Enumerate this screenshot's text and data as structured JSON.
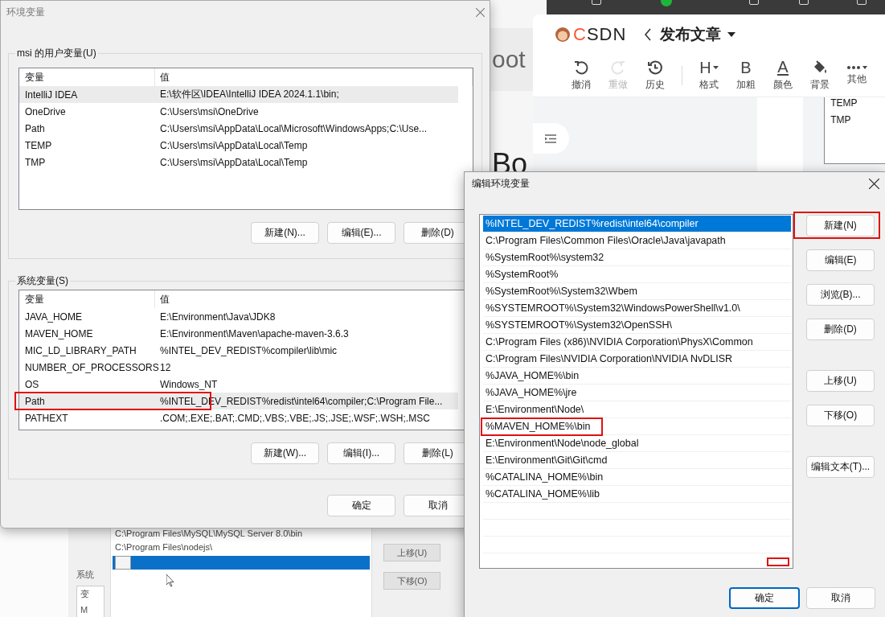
{
  "background_page": {
    "fragments": [
      "oot",
      "Bo"
    ]
  },
  "csdn_editor": {
    "logo": "CSDN",
    "title": "发布文章",
    "toolbar": [
      {
        "kind": "undo",
        "label": "撤消",
        "disabled": false
      },
      {
        "kind": "redo",
        "label": "重做",
        "disabled": true
      },
      {
        "kind": "history",
        "label": "历史",
        "disabled": false
      },
      {
        "kind": "heading",
        "label": "格式",
        "glyph": "H",
        "disabled": false
      },
      {
        "kind": "bold",
        "label": "加粗",
        "glyph": "B",
        "disabled": false
      },
      {
        "kind": "color",
        "label": "颜色",
        "glyph": "A",
        "disabled": false
      },
      {
        "kind": "background",
        "label": "背景",
        "disabled": false
      },
      {
        "kind": "more",
        "label": "其他",
        "disabled": false
      }
    ],
    "side_list": [
      "TEMP",
      "TMP"
    ]
  },
  "back_dialog": {
    "group_label": "系统",
    "column_fragments": [
      "变",
      "M"
    ],
    "entries": [
      "C:\\Program Files\\MySQL\\MySQL Server 8.0\\bin",
      "C:\\Program Files\\nodejs\\"
    ],
    "editing_row": {
      "selected": true
    },
    "buttons": [
      "上移(U)",
      "下移(O)"
    ]
  },
  "env_dialog": {
    "title": "环境变量",
    "groups": [
      {
        "label": "msi 的用户变量(U)",
        "columns": [
          "变量",
          "值"
        ],
        "rows": [
          {
            "name": "IntelliJ IDEA",
            "value": "E:\\软件区\\IDEA\\IntelliJ IDEA 2024.1.1\\bin;",
            "selected": true,
            "highlighted": false
          },
          {
            "name": "OneDrive",
            "value": "C:\\Users\\msi\\OneDrive",
            "selected": false,
            "highlighted": false
          },
          {
            "name": "Path",
            "value": "C:\\Users\\msi\\AppData\\Local\\Microsoft\\WindowsApps;C:\\Use...",
            "selected": false,
            "highlighted": false
          },
          {
            "name": "TEMP",
            "value": "C:\\Users\\msi\\AppData\\Local\\Temp",
            "selected": false,
            "highlighted": false
          },
          {
            "name": "TMP",
            "value": "C:\\Users\\msi\\AppData\\Local\\Temp",
            "selected": false,
            "highlighted": false
          }
        ],
        "buttons": [
          "新建(N)...",
          "编辑(E)...",
          "删除(D)"
        ]
      },
      {
        "label": "系统变量(S)",
        "columns": [
          "变量",
          "值"
        ],
        "rows": [
          {
            "name": "JAVA_HOME",
            "value": "E:\\Environment\\Java\\JDK8",
            "selected": false,
            "highlighted": false
          },
          {
            "name": "MAVEN_HOME",
            "value": "E:\\Environment\\Maven\\apache-maven-3.6.3",
            "selected": false,
            "highlighted": false
          },
          {
            "name": "MIC_LD_LIBRARY_PATH",
            "value": "%INTEL_DEV_REDIST%compiler\\lib\\mic",
            "selected": false,
            "highlighted": false
          },
          {
            "name": "NUMBER_OF_PROCESSORS",
            "value": "12",
            "selected": false,
            "highlighted": false
          },
          {
            "name": "OS",
            "value": "Windows_NT",
            "selected": false,
            "highlighted": false
          },
          {
            "name": "Path",
            "value": "%INTEL_DEV_REDIST%redist\\intel64\\compiler;C:\\Program File...",
            "selected": true,
            "highlighted": true
          },
          {
            "name": "PATHEXT",
            "value": ".COM;.EXE;.BAT;.CMD;.VBS;.VBE;.JS;.JSE;.WSF;.WSH;.MSC",
            "selected": false,
            "highlighted": false
          }
        ],
        "buttons": [
          "新建(W)...",
          "编辑(I)...",
          "删除(L)"
        ]
      }
    ],
    "footer_buttons": [
      "确定",
      "取消"
    ]
  },
  "edit_dialog": {
    "title": "编辑环境变量",
    "entries": [
      {
        "text": "%INTEL_DEV_REDIST%redist\\intel64\\compiler",
        "selected": true,
        "highlighted": false
      },
      {
        "text": "C:\\Program Files\\Common Files\\Oracle\\Java\\javapath",
        "selected": false,
        "highlighted": false
      },
      {
        "text": "%SystemRoot%\\system32",
        "selected": false,
        "highlighted": false
      },
      {
        "text": "%SystemRoot%",
        "selected": false,
        "highlighted": false
      },
      {
        "text": "%SystemRoot%\\System32\\Wbem",
        "selected": false,
        "highlighted": false
      },
      {
        "text": "%SYSTEMROOT%\\System32\\WindowsPowerShell\\v1.0\\",
        "selected": false,
        "highlighted": false
      },
      {
        "text": "%SYSTEMROOT%\\System32\\OpenSSH\\",
        "selected": false,
        "highlighted": false
      },
      {
        "text": "C:\\Program Files (x86)\\NVIDIA Corporation\\PhysX\\Common",
        "selected": false,
        "highlighted": false
      },
      {
        "text": "C:\\Program Files\\NVIDIA Corporation\\NVIDIA NvDLISR",
        "selected": false,
        "highlighted": false
      },
      {
        "text": "%JAVA_HOME%\\bin",
        "selected": false,
        "highlighted": false
      },
      {
        "text": "%JAVA_HOME%\\jre",
        "selected": false,
        "highlighted": false
      },
      {
        "text": "E:\\Environment\\Node\\",
        "selected": false,
        "highlighted": false
      },
      {
        "text": "%MAVEN_HOME%\\bin",
        "selected": false,
        "highlighted": true
      },
      {
        "text": "E:\\Environment\\Node\\node_global",
        "selected": false,
        "highlighted": false
      },
      {
        "text": "E:\\Environment\\Git\\Git\\cmd",
        "selected": false,
        "highlighted": false
      },
      {
        "text": "%CATALINA_HOME%\\bin",
        "selected": false,
        "highlighted": false
      },
      {
        "text": "%CATALINA_HOME%\\lib",
        "selected": false,
        "highlighted": false
      }
    ],
    "blank_rows": [
      {
        "highlighted": false
      },
      {
        "highlighted": false
      },
      {
        "highlighted": false
      },
      {
        "highlighted": true
      }
    ],
    "button_groups": [
      [
        {
          "label": "新建(N)",
          "highlighted": true
        },
        {
          "label": "编辑(E)",
          "highlighted": false
        },
        {
          "label": "浏览(B)...",
          "highlighted": false
        },
        {
          "label": "删除(D)",
          "highlighted": false
        }
      ],
      [
        {
          "label": "上移(U)",
          "highlighted": false
        },
        {
          "label": "下移(O)",
          "highlighted": false
        }
      ],
      [
        {
          "label": "编辑文本(T)...",
          "highlighted": false
        }
      ]
    ],
    "footer_buttons": [
      {
        "label": "确定",
        "default": true
      },
      {
        "label": "取消",
        "default": false
      }
    ]
  }
}
